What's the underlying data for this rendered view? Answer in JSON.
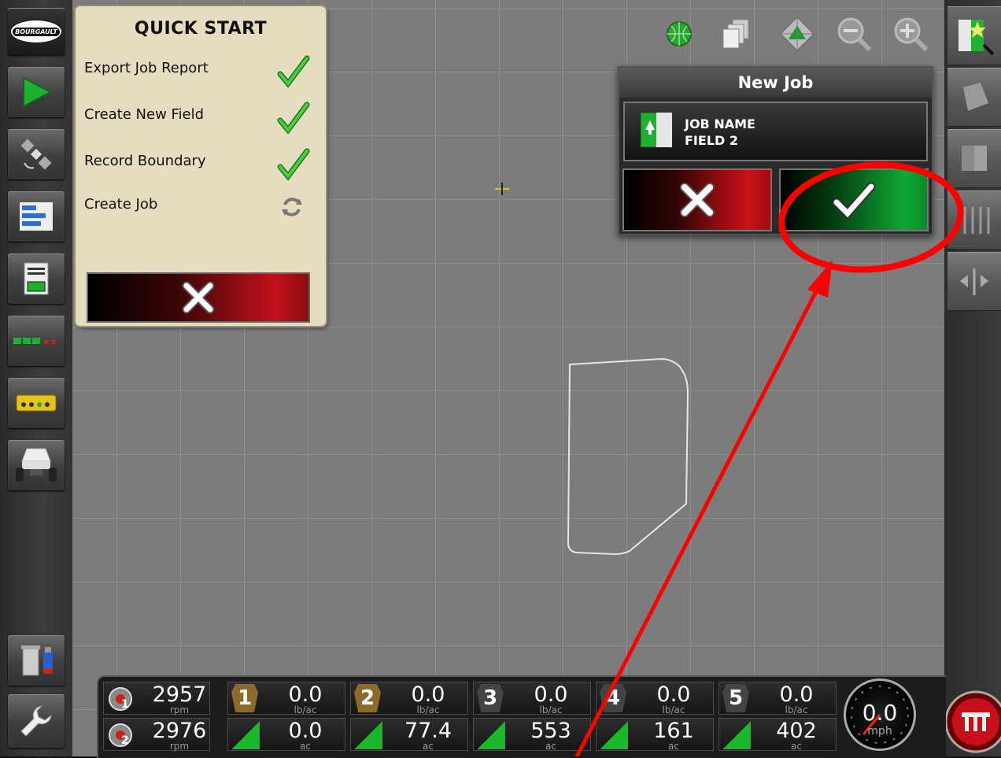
{
  "sidebar": {
    "logo_text": "BOURGAULT",
    "items": [
      {
        "name": "guidance-icon"
      },
      {
        "name": "gps-satellite-icon"
      },
      {
        "name": "bar-list-icon"
      },
      {
        "name": "report-icon"
      },
      {
        "name": "section-status-icon"
      },
      {
        "name": "switchbox-icon"
      },
      {
        "name": "seeder-icon"
      },
      {
        "name": "trash-usb-icon"
      },
      {
        "name": "wrench-icon"
      }
    ]
  },
  "map_tools": [
    "globe-icon",
    "layers-icon",
    "view-mode-icon",
    "zoom-out-icon",
    "zoom-in-icon"
  ],
  "quick_start": {
    "title": "QUICK START",
    "items": [
      {
        "label": "Export Job Report",
        "status": "done"
      },
      {
        "label": "Create New Field",
        "status": "done"
      },
      {
        "label": "Record Boundary",
        "status": "done"
      },
      {
        "label": "Create Job",
        "status": "in-progress"
      }
    ]
  },
  "new_job": {
    "title": "New Job",
    "field_label": "JOB NAME",
    "field_value": "FIELD 2"
  },
  "status_bar": {
    "fans": [
      {
        "index": "1",
        "value": "2957",
        "unit": "rpm"
      },
      {
        "index": "2",
        "value": "2976",
        "unit": "rpm"
      }
    ],
    "sections": [
      {
        "number": "1",
        "rate": "0.0",
        "rate_unit": "lb/ac",
        "area": "0.0",
        "area_unit": "ac"
      },
      {
        "number": "2",
        "rate": "0.0",
        "rate_unit": "lb/ac",
        "area": "77.4",
        "area_unit": "ac"
      },
      {
        "number": "3",
        "rate": "0.0",
        "rate_unit": "lb/ac",
        "area": "553",
        "area_unit": "ac"
      },
      {
        "number": "4",
        "rate": "0.0",
        "rate_unit": "lb/ac",
        "area": "161",
        "area_unit": "ac"
      },
      {
        "number": "5",
        "rate": "0.0",
        "rate_unit": "lb/ac",
        "area": "402",
        "area_unit": "ac"
      }
    ],
    "speed": {
      "value": "0.0",
      "unit": "mph"
    }
  },
  "colors": {
    "accept_green": "#0fa833",
    "cancel_red": "#cc1018",
    "annotation_red": "#ff0000",
    "panel_beige": "#e6dcc0"
  }
}
